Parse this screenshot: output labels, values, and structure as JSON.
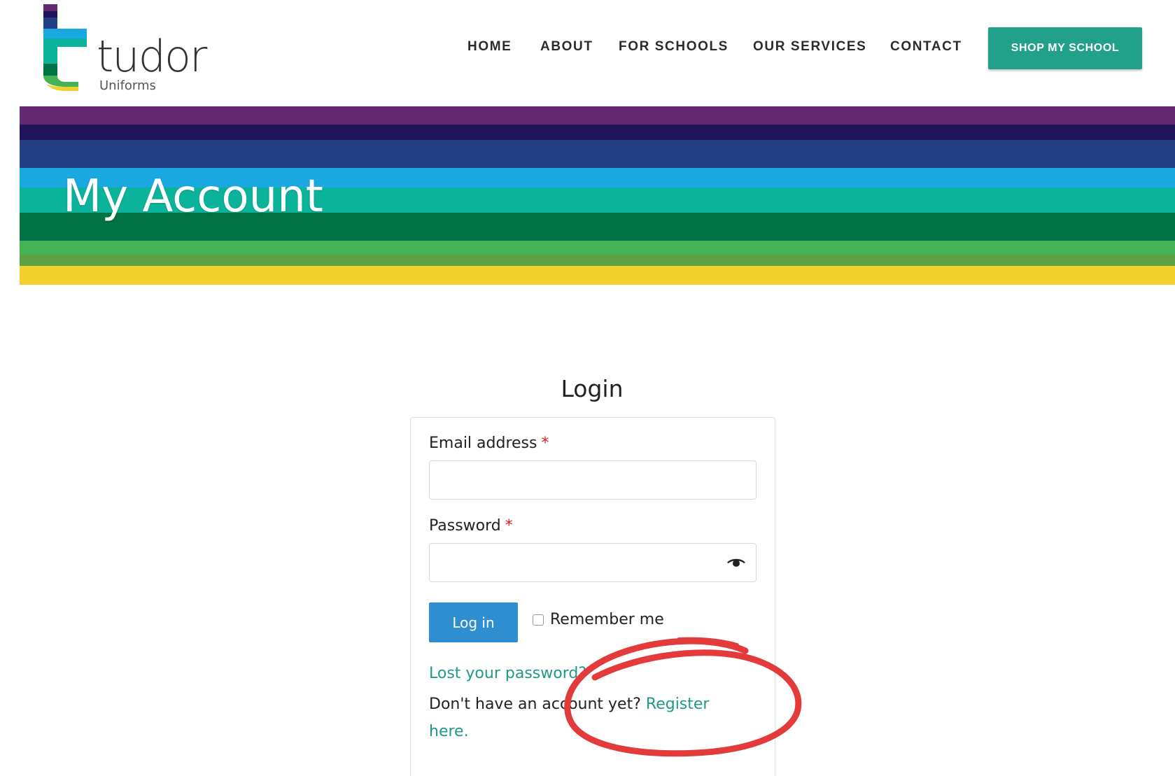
{
  "brand": {
    "wordmark": "tudor",
    "subtitle": "Uniforms"
  },
  "nav": {
    "items": [
      {
        "label": "HOME"
      },
      {
        "label": "ABOUT"
      },
      {
        "label": "FOR SCHOOLS"
      },
      {
        "label": "OUR SERVICES"
      },
      {
        "label": "CONTACT"
      }
    ],
    "cta_label": "SHOP MY SCHOOL"
  },
  "banner": {
    "title": "My Account",
    "stripe_colors": [
      "#632a72",
      "#21145a",
      "#233f86",
      "#19a8e0",
      "#0bb39b",
      "#007243",
      "#45b353",
      "#5ea145",
      "#f2d12d"
    ]
  },
  "login": {
    "heading": "Login",
    "email_label": "Email address",
    "email_value": "",
    "password_label": "Password",
    "password_value": "",
    "required_mark": "*",
    "password_toggle_icon": "eye-icon",
    "submit_label": "Log in",
    "remember_label": "Remember me",
    "remember_checked": false,
    "lost_password_label": "Lost your password?",
    "register_prompt": "Don't have an account yet? ",
    "register_link_label": "Register here."
  },
  "colors": {
    "accent": "#21a08a",
    "link": "#1f9a86",
    "button": "#2f8ecf",
    "required": "#e01b1b",
    "annotation": "#e33b3b"
  }
}
